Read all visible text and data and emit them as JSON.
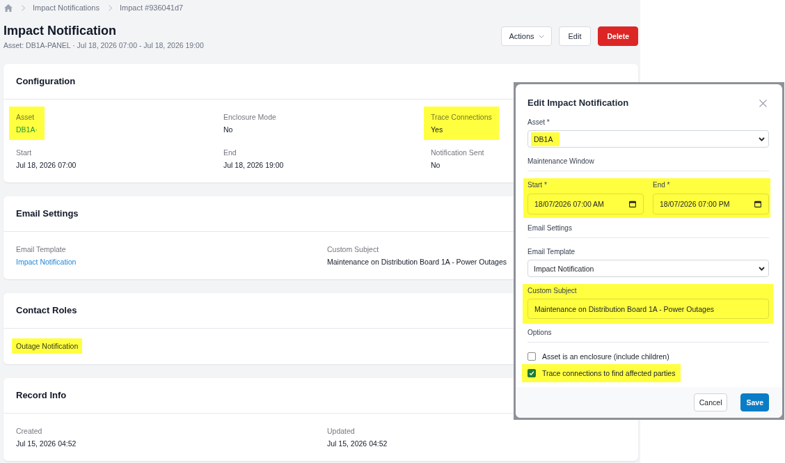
{
  "breadcrumb": [
    {
      "label": "Impact Notifications"
    },
    {
      "label": "Impact #936041d7"
    }
  ],
  "header": {
    "title": "Impact Notification",
    "subtitle": "Asset: DB1A-PANEL · Jul 18, 2026 07:00 - Jul 18, 2026 19:00"
  },
  "actions": [
    {
      "label": "Actions",
      "kind": "dropdown"
    },
    {
      "label": "Edit",
      "kind": "default"
    },
    {
      "label": "Delete",
      "kind": "danger"
    }
  ],
  "cards": [
    {
      "title": "Configuration",
      "kind": "fields",
      "rows": [
        [
          {
            "label": "Asset",
            "value": "DB1A·",
            "kind": "link",
            "highlighted": true
          },
          {
            "label": "Enclosure Mode",
            "value": "No",
            "kind": "text",
            "highlighted": false
          },
          {
            "label": "Trace Connections",
            "value": "Yes",
            "kind": "text",
            "highlighted": true
          }
        ],
        [
          {
            "label": "Start",
            "value": "Jul 18, 2026 07:00",
            "kind": "text",
            "highlighted": false
          },
          {
            "label": "End",
            "value": "Jul 18, 2026 19:00",
            "kind": "text",
            "highlighted": false
          },
          {
            "label": "Notification Sent",
            "value": "No",
            "kind": "text",
            "highlighted": false
          }
        ]
      ]
    },
    {
      "title": "Email Settings",
      "kind": "fields",
      "rows": [
        [
          {
            "label": "Email Template",
            "value": "Impact Notification",
            "kind": "link",
            "highlighted": false
          },
          {
            "label": "Custom Subject",
            "value": "Maintenance on Distribution Board 1A - Power Outages",
            "kind": "text",
            "highlighted": false
          }
        ]
      ]
    },
    {
      "title": "Contact Roles",
      "kind": "list",
      "items": [
        {
          "label": "Outage Notification",
          "highlighted": true
        }
      ]
    },
    {
      "title": "Record Info",
      "kind": "fields",
      "rows": [
        [
          {
            "label": "Created",
            "value": "Jul 15, 2026 04:52",
            "kind": "text",
            "highlighted": false
          },
          {
            "label": "Updated",
            "value": "Jul 15, 2026 04:52",
            "kind": "text",
            "highlighted": false
          }
        ]
      ]
    }
  ],
  "dialog": {
    "title": "Edit Impact Notification",
    "items": [
      {
        "kind": "select",
        "label": "Asset *",
        "value": "DB1A",
        "highlighted": true
      },
      {
        "kind": "heading",
        "label": "Maintenance Window",
        "highlighted": false
      },
      {
        "kind": "date-pair",
        "highlighted": true,
        "fields": [
          {
            "label": "Start *",
            "value": "18/07/2026 07:00 AM"
          },
          {
            "label": "End *",
            "value": "18/07/2026 07:00 PM"
          }
        ]
      },
      {
        "kind": "heading",
        "label": "Email Settings",
        "highlighted": false
      },
      {
        "kind": "select",
        "label": "Email Template",
        "value": "Impact Notification",
        "highlighted": false
      },
      {
        "kind": "text",
        "label": "Custom Subject",
        "value": "Maintenance on Distribution Board 1A - Power Outages",
        "highlighted": true
      },
      {
        "kind": "heading",
        "label": "Options",
        "highlighted": false
      },
      {
        "kind": "checkbox",
        "label": "Asset is an enclosure (include children)",
        "checked": false,
        "highlighted": false
      },
      {
        "kind": "checkbox",
        "label": "Trace connections to find affected parties",
        "checked": true,
        "highlighted": true
      }
    ],
    "buttons": [
      {
        "label": "Cancel",
        "kind": "secondary"
      },
      {
        "label": "Save",
        "kind": "primary"
      }
    ]
  }
}
